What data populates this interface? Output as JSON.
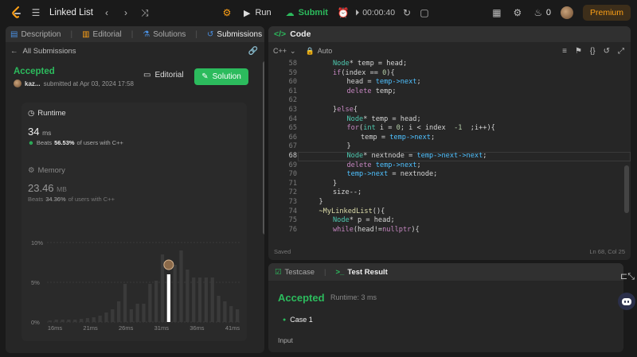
{
  "topbar": {
    "title": "Linked List",
    "run_label": "Run",
    "submit_label": "Submit",
    "timer": "00:00:40",
    "fire_count": "0",
    "premium_label": "Premium"
  },
  "left": {
    "tabs": [
      {
        "label": "Description",
        "icon": "description-icon"
      },
      {
        "label": "Editorial",
        "icon": "book-icon"
      },
      {
        "label": "Solutions",
        "icon": "flask-icon"
      },
      {
        "label": "Submissions",
        "icon": "history-icon"
      }
    ],
    "all_submissions": "All Submissions",
    "status": "Accepted",
    "user": "kaz...",
    "submitted_at": "submitted at Apr 03, 2024 17:58",
    "editorial_btn": "Editorial",
    "solution_btn": "Solution",
    "runtime_label": "Runtime",
    "runtime_value": "34",
    "runtime_unit": "ms",
    "beats_label": "Beats",
    "runtime_pct": "56.53%",
    "runtime_suffix": "of users with C++",
    "memory_label": "Memory",
    "memory_value": "23.46",
    "memory_unit": "MB",
    "memory_pct": "34.36%",
    "memory_suffix": "of users with C++"
  },
  "chart_data": {
    "type": "bar",
    "y_ticks": [
      "10%",
      "5%",
      "0%"
    ],
    "ylim": [
      0,
      10
    ],
    "x_ticks": [
      "16ms",
      "21ms",
      "26ms",
      "31ms",
      "36ms",
      "41ms"
    ],
    "values": [
      0.2,
      0.3,
      0.3,
      0.3,
      0.3,
      0.4,
      0.5,
      0.6,
      0.8,
      1.2,
      1.6,
      2.6,
      4.8,
      1.6,
      2.3,
      2.3,
      4.8,
      5.2,
      8.5,
      6.0,
      7.2,
      9.0,
      6.6,
      5.6,
      5.6,
      5.6,
      5.6,
      3.3,
      2.6,
      2.0,
      1.6
    ],
    "highlight_index": 19,
    "highlight_color": "#ffffff",
    "bar_color": "#3a3a3a"
  },
  "code": {
    "header": "Code",
    "language": "C++",
    "mode": "Auto",
    "lines": [
      {
        "n": "58",
        "indent": 2,
        "tokens": [
          [
            "ty",
            "Node"
          ],
          [
            "vr",
            "* temp = head;"
          ]
        ]
      },
      {
        "n": "59",
        "indent": 2,
        "tokens": [
          [
            "kw",
            "if"
          ],
          [
            "vr",
            "(index == "
          ],
          [
            "nm",
            "0"
          ],
          [
            "vr",
            "){"
          ]
        ]
      },
      {
        "n": "60",
        "indent": 3,
        "tokens": [
          [
            "vr",
            "head = "
          ],
          [
            "ac",
            "temp->next"
          ],
          [
            "vr",
            ";"
          ]
        ]
      },
      {
        "n": "61",
        "indent": 3,
        "tokens": [
          [
            "kw",
            "delete"
          ],
          [
            "vr",
            " temp;"
          ]
        ]
      },
      {
        "n": "62",
        "indent": 0,
        "tokens": []
      },
      {
        "n": "63",
        "indent": 2,
        "tokens": [
          [
            "vr",
            "}"
          ],
          [
            "kw",
            "else"
          ],
          [
            "vr",
            "{"
          ]
        ]
      },
      {
        "n": "64",
        "indent": 3,
        "tokens": [
          [
            "ty",
            "Node"
          ],
          [
            "vr",
            "* temp = head;"
          ]
        ]
      },
      {
        "n": "65",
        "indent": 3,
        "tokens": [
          [
            "kw",
            "for"
          ],
          [
            "vr",
            "("
          ],
          [
            "ty",
            "int"
          ],
          [
            "vr",
            " i = "
          ],
          [
            "nm",
            "0"
          ],
          [
            "vr",
            "; i < index  "
          ],
          [
            "nm",
            "-1"
          ],
          [
            "vr",
            "  ;i++){"
          ]
        ]
      },
      {
        "n": "66",
        "indent": 4,
        "tokens": [
          [
            "vr",
            "temp = "
          ],
          [
            "ac",
            "temp->next"
          ],
          [
            "vr",
            ";"
          ]
        ]
      },
      {
        "n": "67",
        "indent": 3,
        "tokens": [
          [
            "vr",
            "}"
          ]
        ]
      },
      {
        "n": "68",
        "indent": 3,
        "tokens": [
          [
            "ty",
            "Node"
          ],
          [
            "vr",
            "* nextnode = "
          ],
          [
            "ac",
            "temp->next->next"
          ],
          [
            "vr",
            ";"
          ]
        ]
      },
      {
        "n": "69",
        "indent": 3,
        "tokens": [
          [
            "kw",
            "delete"
          ],
          [
            "vr",
            " "
          ],
          [
            "ac",
            "temp->next"
          ],
          [
            "vr",
            ";"
          ]
        ]
      },
      {
        "n": "70",
        "indent": 3,
        "tokens": [
          [
            "ac",
            "temp->next"
          ],
          [
            "vr",
            " = nextnode;"
          ]
        ]
      },
      {
        "n": "71",
        "indent": 2,
        "tokens": [
          [
            "vr",
            "}"
          ]
        ]
      },
      {
        "n": "72",
        "indent": 2,
        "tokens": [
          [
            "vr",
            "size--;"
          ]
        ]
      },
      {
        "n": "73",
        "indent": 1,
        "tokens": [
          [
            "vr",
            "}"
          ]
        ]
      },
      {
        "n": "74",
        "indent": 1,
        "tokens": [
          [
            "fn",
            "~MyLinkedList"
          ],
          [
            "vr",
            "(){"
          ]
        ]
      },
      {
        "n": "75",
        "indent": 2,
        "tokens": [
          [
            "ty",
            "Node"
          ],
          [
            "vr",
            "* p = head;"
          ]
        ]
      },
      {
        "n": "76",
        "indent": 2,
        "tokens": [
          [
            "kw",
            "while"
          ],
          [
            "vr",
            "(head!="
          ],
          [
            "kw",
            "nullptr"
          ],
          [
            "vr",
            "){"
          ]
        ]
      }
    ],
    "current_line": "68",
    "saved": "Saved",
    "cursor": "Ln 68, Col 25"
  },
  "result": {
    "tab_testcase": "Testcase",
    "tab_result": "Test Result",
    "status": "Accepted",
    "runtime": "Runtime: 3 ms",
    "case": "Case 1",
    "input_label": "Input"
  }
}
